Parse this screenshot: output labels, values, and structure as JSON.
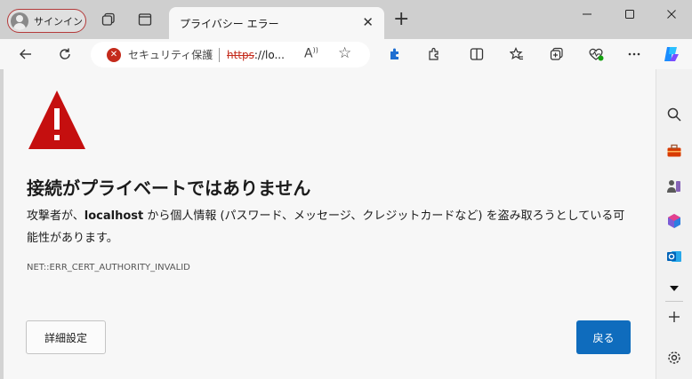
{
  "colors": {
    "accent": "#0f6cbd",
    "error_red": "#c42b1c",
    "warning_red": "#c50f0f"
  },
  "titlebar": {
    "profile_label": "サインイン",
    "tab_title": "プライバシー エラー"
  },
  "address": {
    "security_label": "セキュリティ保護な",
    "url_scheme": "https",
    "url_rest": "://lo..."
  },
  "error_page": {
    "heading": "接続がプライベートではありません",
    "message_before": "攻撃者が、",
    "host": "localhost",
    "message_after": " から個人情報 (パスワード、メッセージ、クレジットカードなど) を盗み取ろうとしている可能性があります。",
    "error_code": "NET::ERR_CERT_AUTHORITY_INVALID",
    "details_button": "詳細設定",
    "back_button": "戻る"
  },
  "icons": {
    "titlebar": [
      "collections-icon",
      "vertical-tabs-icon"
    ],
    "toolbar": [
      "back-arrow-icon",
      "refresh-icon",
      "extension-icon",
      "puzzle-icon",
      "split-screen-icon",
      "favorites-icon",
      "collections-add-icon",
      "heartbeat-icon",
      "more-icon",
      "copilot-icon"
    ],
    "sidebar": [
      "search-icon",
      "toolbox-icon",
      "games-icon",
      "office-icon",
      "outlook-icon",
      "dropdown-icon",
      "add-icon",
      "settings-icon"
    ]
  }
}
